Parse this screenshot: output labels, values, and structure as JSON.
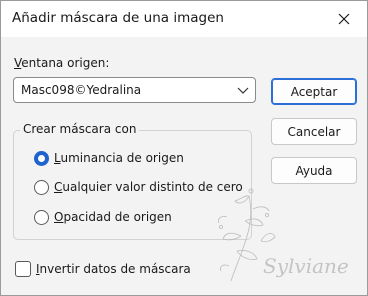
{
  "window": {
    "title": "Añadir máscara de una imagen",
    "close_icon": "close-icon"
  },
  "source": {
    "label_first": "V",
    "label_rest": "entana origen:",
    "selected_value": "Masc098©Yedralina"
  },
  "buttons": {
    "accept": "Aceptar",
    "cancel": "Cancelar",
    "help": "Ayuda"
  },
  "mask_group": {
    "title": "Crear máscara con",
    "options": [
      {
        "first": "L",
        "rest": "uminancia de origen",
        "checked": true
      },
      {
        "first": "C",
        "rest": "ualquier valor distinto de cero",
        "checked": false
      },
      {
        "first": "O",
        "rest": "pacidad de origen",
        "checked": false
      }
    ]
  },
  "invert": {
    "first": "I",
    "rest": "nvertir datos de máscara",
    "checked": false
  },
  "watermark": {
    "text": "Sylviane"
  },
  "colors": {
    "accent": "#1f63cf",
    "dialog_bg": "#f3f3f3",
    "titlebar_bg": "#ffffff"
  }
}
